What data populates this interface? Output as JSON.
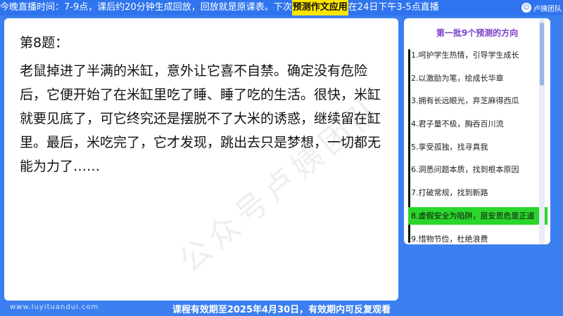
{
  "banner": {
    "part1": "今晚直播时间：7-9点，课后约20分钟生成回放，回放就是原课表。下次",
    "highlight": "预测作文应用",
    "part2": "在24日下午3-5点直播",
    "brand": "卢姨团队"
  },
  "question": {
    "title": "第8题：",
    "body": "老鼠掉进了半满的米缸，意外让它喜不自禁。确定没有危险后，它便开始了在米缸里吃了睡、睡了吃的生活。很快，米缸就要见底了，可它终究还是摆脱不了大米的诱惑，继续留在缸里。最后，米吃完了，它才发现，跳出去只是梦想，一切都无能为力了……",
    "watermark": "公众号卢姨团队"
  },
  "sidebar": {
    "title": "第一批9个预测的方向",
    "items": [
      {
        "label": "1.呵护学生热情，引导学生成长"
      },
      {
        "label": "2.以激励为笔，绘成长华章"
      },
      {
        "label": "3.拥有长远眼光，弃芝麻得西瓜"
      },
      {
        "label": "4.君子量不极，胸吞百川流"
      },
      {
        "label": "5.享受孤独，找寻真我"
      },
      {
        "label": "6.洞悉问题本质，找到根本原因"
      },
      {
        "label": "7.打破常规，找到新路"
      },
      {
        "label": "8.虚假安全为陷阱，居安思危是正道"
      },
      {
        "label": "9.惜物节俭，杜绝浪费"
      }
    ],
    "active_index": 7,
    "active_color": "#2bd62b"
  },
  "footer": {
    "website": "www.luyituandui.com",
    "notice": "课程有效期至2025年4月30日，有效期内可反复观看"
  },
  "colors": {
    "background": "#3b7ff0",
    "highlight": "#ffe600",
    "sidebar_title": "#7a3ec9"
  }
}
